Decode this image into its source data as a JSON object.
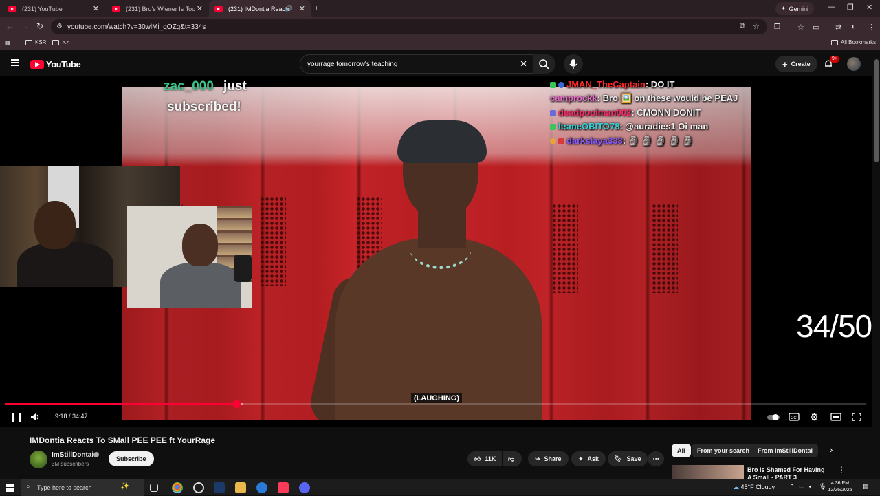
{
  "browser": {
    "tabs": [
      {
        "title": "(231) YouTube"
      },
      {
        "title": "(231) Bro's Wiener Is Too Big F..."
      },
      {
        "title": "(231) IMDontia Reacts To SM..."
      }
    ],
    "gemini_label": "Gemini",
    "url": "youtube.com/watch?v=30wlMi_qOZg&t=334s",
    "bookmarks": [
      {
        "label": "KSR"
      },
      {
        "label": ">.<"
      }
    ],
    "all_bookmarks_label": "All Bookmarks"
  },
  "youtube": {
    "logo_text": "YouTube",
    "search": {
      "value": "yourrage tomorrow's teaching"
    },
    "create_label": "Create",
    "notifications_badge": "9+"
  },
  "player": {
    "subscribe_overlay": {
      "name": "zac_000",
      "line1": "just",
      "line2": "subscribed!"
    },
    "chat": [
      {
        "user": "JMAN_TheCaptain",
        "user_color": "#ff2a2a",
        "message": ": DO IT"
      },
      {
        "user": "camprockk",
        "user_color": "#e86cc8",
        "message": ": Bro 🖼️ on these would be PEAJ"
      },
      {
        "user": "deadpoolman002",
        "user_color": "#ff2a6a",
        "message": ": CMONN DONIT"
      },
      {
        "user": "ItsmeOBITO78",
        "user_color": "#34d2d8",
        "message": ": @auradies1 Oi man"
      },
      {
        "user": "darkslaya333",
        "user_color": "#8a5cff",
        "message": ": 🗿 🗿 🗿 🗿 🗿"
      }
    ],
    "counter": "34/50",
    "caption": "(LAUGHING)",
    "time": "9:18 / 34:47",
    "progress_played": 0.268,
    "progress_buffered": 0.276
  },
  "video": {
    "title": "IMDontia Reacts To SMall PEE PEE ft YourRage",
    "channel_name": "ImStillDontai",
    "subscribers": "3M subscribers",
    "subscribe_label": "Subscribe",
    "likes": "11K",
    "share_label": "Share",
    "ask_label": "Ask",
    "save_label": "Save"
  },
  "recommendations": {
    "chips": [
      {
        "label": "All"
      },
      {
        "label": "From your search"
      },
      {
        "label": "From ImStillDontai"
      }
    ],
    "first_title": "Bro Is Shamed For Having A Small - PART 3"
  },
  "taskbar": {
    "search_placeholder": "Type here to search",
    "weather": "45°F  Cloudy",
    "time": "4:36 PM",
    "date": "12/26/2025"
  },
  "colors": {
    "accent": "#ff0033",
    "background": "#0f0f0f"
  }
}
